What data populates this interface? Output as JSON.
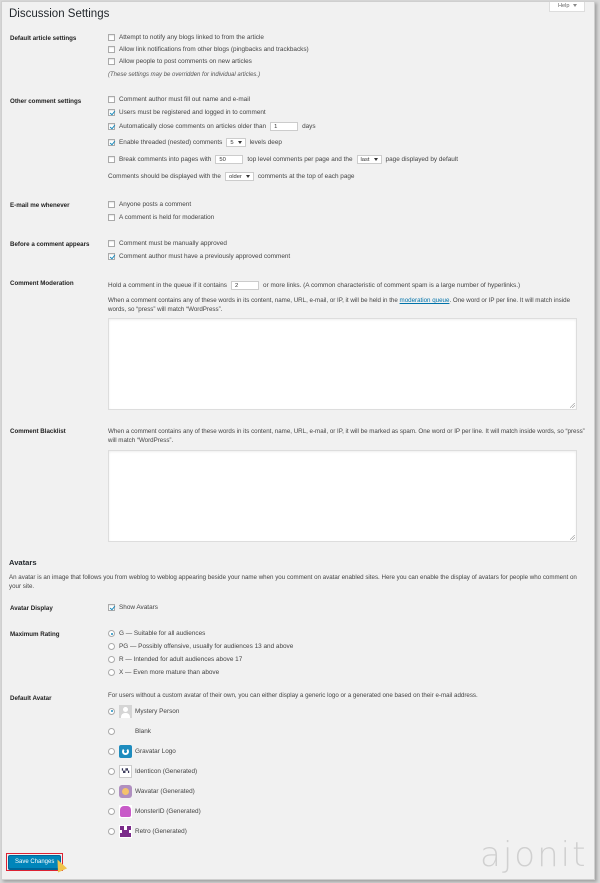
{
  "page": {
    "title": "Discussion Settings",
    "help_label": "Help"
  },
  "default_article": {
    "label": "Default article settings",
    "items": [
      {
        "text": "Attempt to notify any blogs linked to from the article",
        "checked": false
      },
      {
        "text": "Allow link notifications from other blogs (pingbacks and trackbacks)",
        "checked": false
      },
      {
        "text": "Allow people to post comments on new articles",
        "checked": false
      }
    ],
    "note": "(These settings may be overridden for individual articles.)"
  },
  "other_comment": {
    "label": "Other comment settings",
    "author_fill": "Comment author must fill out name and e-mail",
    "registered": "Users must be registered and logged in to comment",
    "close_prefix": "Automatically close comments on articles older than",
    "close_value": "1",
    "close_suffix": "days",
    "threaded_prefix": "Enable threaded (nested) comments",
    "threaded_value": "5",
    "threaded_suffix": "levels deep",
    "break_prefix": "Break comments into pages with",
    "break_value": "50",
    "break_mid": "top level comments per page and the",
    "break_select": "last",
    "break_suffix": "page displayed by default",
    "display_prefix": "Comments should be displayed with the",
    "display_select": "older",
    "display_suffix": "comments at the top of each page"
  },
  "email_me": {
    "label": "E-mail me whenever",
    "items": [
      {
        "text": "Anyone posts a comment",
        "checked": false
      },
      {
        "text": "A comment is held for moderation",
        "checked": false
      }
    ]
  },
  "before_appears": {
    "label": "Before a comment appears",
    "items": [
      {
        "text": "Comment must be manually approved",
        "checked": false
      },
      {
        "text": "Comment author must have a previously approved comment",
        "checked": true
      }
    ]
  },
  "moderation": {
    "label": "Comment Moderation",
    "hold_prefix": "Hold a comment in the queue if it contains",
    "hold_value": "2",
    "hold_suffix": "or more links. (A common characteristic of comment spam is a large number of hyperlinks.)",
    "desc_prefix": "When a comment contains any of these words in its content, name, URL, e-mail, or IP, it will be held in the",
    "desc_link": "moderation queue",
    "desc_suffix": ". One word or IP per line. It will match inside words, so “press” will match “WordPress”."
  },
  "blacklist": {
    "label": "Comment Blacklist",
    "desc": "When a comment contains any of these words in its content, name, URL, e-mail, or IP, it will be marked as spam. One word or IP per line. It will match inside words, so “press” will match “WordPress”."
  },
  "avatars": {
    "heading": "Avatars",
    "desc": "An avatar is an image that follows you from weblog to weblog appearing beside your name when you comment on avatar enabled sites. Here you can enable the display of avatars for people who comment on your site.",
    "display_label": "Avatar Display",
    "show_avatars": "Show Avatars",
    "rating_label": "Maximum Rating",
    "ratings": [
      {
        "text": "G — Suitable for all audiences",
        "checked": true
      },
      {
        "text": "PG — Possibly offensive, usually for audiences 13 and above",
        "checked": false
      },
      {
        "text": "R — Intended for adult audiences above 17",
        "checked": false
      },
      {
        "text": "X — Even more mature than above",
        "checked": false
      }
    ],
    "default_label": "Default Avatar",
    "default_desc": "For users without a custom avatar of their own, you can either display a generic logo or a generated one based on their e-mail address.",
    "defaults": [
      {
        "text": "Mystery Person",
        "icon": "mystery-person-icon",
        "checked": true
      },
      {
        "text": "Blank",
        "icon": "blank-icon",
        "checked": false
      },
      {
        "text": "Gravatar Logo",
        "icon": "gravatar-logo-icon",
        "checked": false
      },
      {
        "text": "Identicon (Generated)",
        "icon": "identicon-icon",
        "checked": false
      },
      {
        "text": "Wavatar (Generated)",
        "icon": "wavatar-icon",
        "checked": false
      },
      {
        "text": "MonsterID (Generated)",
        "icon": "monsterid-icon",
        "checked": false
      },
      {
        "text": "Retro (Generated)",
        "icon": "retro-icon",
        "checked": false
      }
    ]
  },
  "footer": {
    "save_label": "Save Changes",
    "watermark": "ajonit"
  },
  "colors": {
    "accent": "#0085ba",
    "link": "#0073aa",
    "highlight": "#dd2233"
  }
}
